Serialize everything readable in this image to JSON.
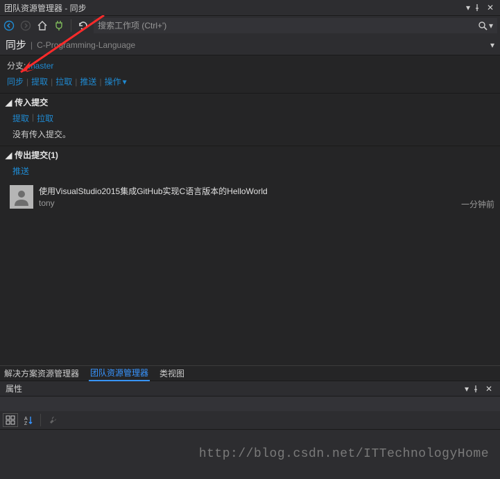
{
  "window": {
    "title": "团队资源管理器 - 同步"
  },
  "search": {
    "placeholder": "搜索工作项 (Ctrl+')"
  },
  "header": {
    "main": "同步",
    "sub": "C-Programming-Language"
  },
  "branch": {
    "label": "分支:",
    "name": "master"
  },
  "actions": {
    "sync": "同步",
    "fetch": "提取",
    "pull": "拉取",
    "push": "推送",
    "ops": "操作"
  },
  "incoming": {
    "title": "传入提交",
    "fetch": "提取",
    "pull": "拉取",
    "empty": "没有传入提交。"
  },
  "outgoing": {
    "title": "传出提交(1)",
    "push": "推送",
    "commits": [
      {
        "message": "使用VisualStudio2015集成GitHub实现C语言版本的HelloWorld",
        "author": "tony",
        "time": "一分钟前"
      }
    ]
  },
  "bottomTabs": {
    "solution": "解决方案资源管理器",
    "team": "团队资源管理器",
    "classview": "类视图"
  },
  "properties": {
    "title": "属性"
  },
  "watermark": "http://blog.csdn.net/ITTechnologyHome"
}
